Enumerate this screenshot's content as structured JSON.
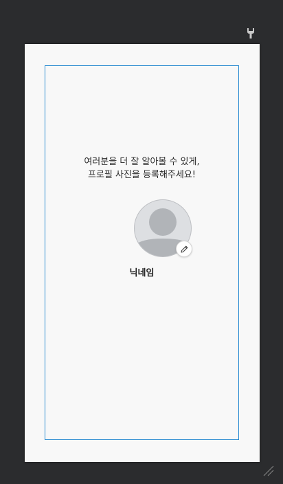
{
  "profile_setup": {
    "intro_line_1": "여러분을 더 잘 알아볼 수 있게,",
    "intro_line_2": "프로필 사진을 등록해주세요!",
    "nickname": "닉네임"
  },
  "icons": {
    "toolbar": "wrench-icon",
    "avatar": "default-avatar-icon",
    "edit": "pencil-icon",
    "grip": "resize-grip-icon"
  },
  "colors": {
    "workspace_background": "#2b2c2e",
    "device_background": "#f8f8f8",
    "layout_guide": "#2a8bd1",
    "avatar_fill": "#dddfe2",
    "avatar_silhouette": "#b1b4b8"
  }
}
